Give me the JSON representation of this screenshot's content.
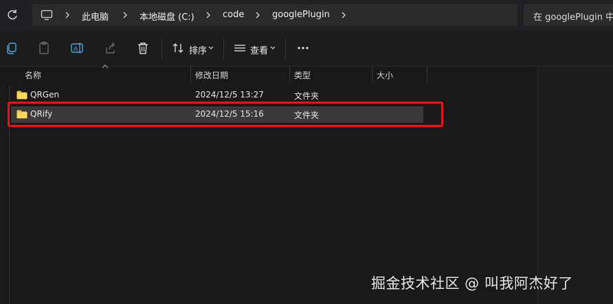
{
  "breadcrumb": {
    "items": [
      "此电脑",
      "本地磁盘 (C:)",
      "code",
      "googlePlugin"
    ]
  },
  "search": {
    "placeholder": "在 googlePlugin 中"
  },
  "toolbar": {
    "sort_label": "排序",
    "view_label": "查看"
  },
  "columns": [
    "名称",
    "修改日期",
    "类型",
    "大小"
  ],
  "files": [
    {
      "name": "QRGen",
      "modified": "2024/12/5 13:27",
      "type": "文件夹",
      "size": ""
    },
    {
      "name": "QRify",
      "modified": "2024/12/5 15:16",
      "type": "文件夹",
      "size": "",
      "selected": true
    }
  ],
  "watermark": "掘金技术社区 @ 叫我阿杰好了",
  "colors": {
    "highlight": "#e0181c",
    "folder": "#f4c542",
    "selection": "#3a3a3a"
  }
}
